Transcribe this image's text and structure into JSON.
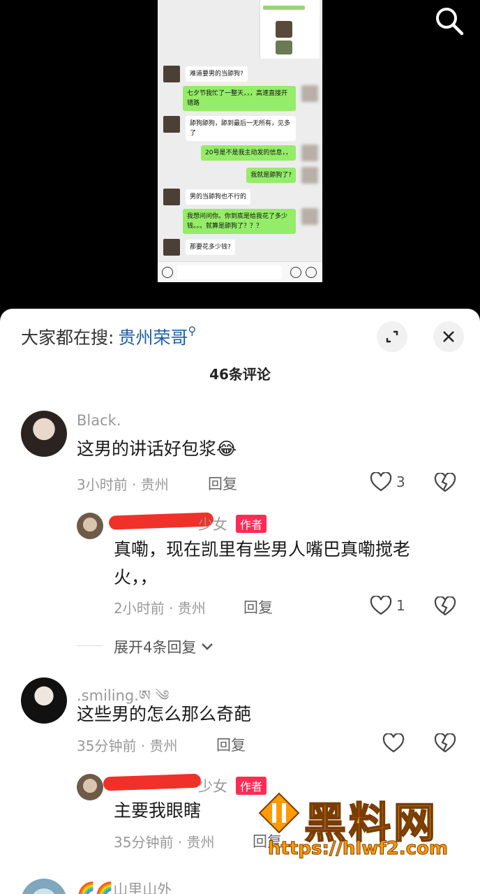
{
  "chat": {
    "messages": [
      {
        "dir": "in",
        "text": "难道要男的当舔狗?"
      },
      {
        "dir": "out",
        "text": "七夕节我忙了一整天，，，高速直接开错路"
      },
      {
        "dir": "in",
        "text": "舔狗舔狗，舔到最后一无所有，见多了"
      },
      {
        "dir": "out",
        "text": "20号是不是我主动发的信息，，"
      },
      {
        "dir": "out",
        "text": "我就是舔狗了?"
      },
      {
        "dir": "in",
        "text": "男的当舔狗也不行的"
      },
      {
        "dir": "out",
        "text": "我想问问你。你到底是给我花了多少钱。。。就算是舔狗了？？？"
      },
      {
        "dir": "in",
        "text": "那要花多少钱?"
      }
    ]
  },
  "sheet": {
    "search_prefix": "大家都在搜:",
    "search_keyword": "贵州荣哥",
    "comment_count": "46条评论"
  },
  "comments": [
    {
      "nick": "Black.",
      "text": "这男的讲话好包浆😂",
      "meta": "3小时前 · 贵州",
      "reply": "回复",
      "likes": "3"
    },
    {
      "nick": "少女",
      "badge": "作者",
      "text_line1": "真嘞，现在凯里有些男人嘴巴真嘞搅老",
      "text_line2": "火，，",
      "meta": "2小时前 · 贵州",
      "reply": "回复",
      "likes": "1"
    },
    {
      "expand": "展开4条回复"
    },
    {
      "nick": ".smiling.ཨ ༄",
      "text": "这些男的怎么那么奇葩",
      "meta": "35分钟前 · 贵州",
      "reply": "回复",
      "likes": ""
    },
    {
      "nick": "少女",
      "badge": "作者",
      "text": "主要我眼瞎",
      "meta": "35分钟前 · 贵州",
      "reply": "回复"
    },
    {
      "nick": "🌈🌈山里山外"
    }
  ],
  "watermark": {
    "title": "黑料网",
    "url": "https://hlwf2.com"
  },
  "colors": {
    "accent_red": "#fe2c55",
    "link_blue": "#1e5fa5",
    "wechat_green": "#95ec69"
  }
}
